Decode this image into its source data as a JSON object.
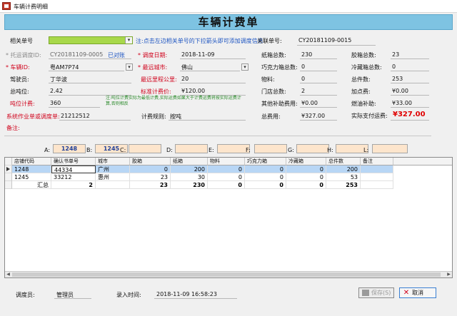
{
  "window": {
    "title": "车辆计费明细"
  },
  "form": {
    "title": "车辆计费单",
    "related_no_label": "相关单号",
    "hint": "注:点击左边相关单号的下拉箭头即可添加调度信息",
    "related_no2_label": "关联单号:",
    "related_no2": "CY20181109-0015",
    "trust_label": "* 托运调度ID:",
    "trust_value": "CY20181109-0005",
    "trust_status": "已对账",
    "dispatch_date_label": "* 调度日期:",
    "dispatch_date": "2018-11-09",
    "carton_total_label": "纸箱总数:",
    "carton_total": "230",
    "plastic_total_label": "胶箱总数:",
    "plastic_total": "23",
    "vehicle_label": "* 车辆ID:",
    "vehicle_value": "粤AM7P74",
    "farthest_city_label": "* 最远城市:",
    "farthest_city": "佛山",
    "choc_total_label": "巧克力箱总数:",
    "choc_total": "0",
    "cold_total_label": "冷藏箱总数:",
    "cold_total": "0",
    "driver_label": "驾驶员:",
    "driver": "丁华波",
    "farthest_km_label": "最远里程公里:",
    "farthest_km": "20",
    "material_label": "物料:",
    "material": "0",
    "pieces_total_label": "总件数:",
    "pieces_total": "253",
    "tonnage_label": "总吨位:",
    "tonnage": "2.42",
    "std_fee_label": "标准计费价:",
    "std_fee": "¥120.00",
    "store_total_label": "门店总数:",
    "store_total": "2",
    "add_fee_label": "加点费:",
    "add_fee": "¥0.00",
    "ton_fee_label": "吨位计费:",
    "ton_fee": "360",
    "note": "注:吨位计费实际为最低计费,实际运费如果大于计费运费将按实际运费计算,否则相反",
    "other_sub_label": "其他补助费用:",
    "other_sub": "¥0.00",
    "fuel_sub_label": "燃油补助:",
    "fuel_sub": "¥33.00",
    "sys_no_label": "系统作业单或调度单:",
    "sys_no": "21212512",
    "rule_label": "计费规则:",
    "rule": "按吨",
    "total_fee_label": "总费用:",
    "total_fee": "¥327.00",
    "actual_fee_label": "实际支付运费:",
    "actual_fee": "¥327.00",
    "remark_label": "备注:"
  },
  "summary": {
    "a_label": "A:",
    "a": "1248",
    "b_label": "B:",
    "b": "1245",
    "c_label": "C:",
    "d_label": "D:",
    "e_label": "E:",
    "f_label": "F:",
    "g_label": "G:",
    "h_label": "H:",
    "l_label": "L:"
  },
  "table": {
    "headers": [
      "店铺代码",
      "确认书单号",
      "城市",
      "胶箱",
      "纸箱",
      "物料",
      "巧克力箱",
      "冷藏箱",
      "总件数",
      "备注"
    ],
    "rows": [
      [
        "1248",
        "44334",
        "广州",
        "0",
        "200",
        "0",
        "0",
        "0",
        "200",
        ""
      ],
      [
        "1245",
        "33212",
        "惠州",
        "23",
        "30",
        "0",
        "0",
        "0",
        "53",
        ""
      ]
    ],
    "total_label": "汇总",
    "totals": [
      "2",
      "",
      "23",
      "230",
      "0",
      "0",
      "0",
      "253",
      ""
    ]
  },
  "footer": {
    "dispatcher_label": "调度员:",
    "dispatcher": "管理员",
    "entry_time_label": "录入时间:",
    "entry_time": "2018-11-09 16:58:23",
    "save_label": "保存(S)",
    "cancel_label": "取消"
  },
  "colors": {
    "banner": "#7ec3e2",
    "required_label": "#d0021b",
    "link_blue": "#1f56c2",
    "highlight_green": "#a8d84a",
    "summary_box": "#fde5cc",
    "row_selected": "#b8d6f5"
  }
}
